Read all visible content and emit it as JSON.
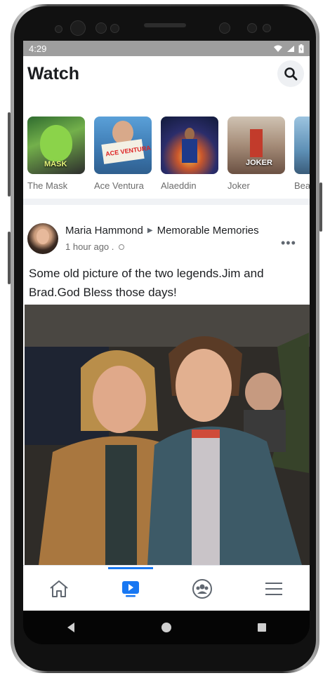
{
  "status_bar": {
    "time": "4:29"
  },
  "header": {
    "title": "Watch"
  },
  "shows": [
    {
      "name": "The Mask",
      "poster_text": "MASK",
      "color": "#3a7a3a"
    },
    {
      "name": "Ace Ventura",
      "poster_text": "ACE VENTURA",
      "color": "#4a8fc7"
    },
    {
      "name": "Alaeddin",
      "poster_text": "",
      "color": "#1f2f6b"
    },
    {
      "name": "Joker",
      "poster_text": "JOKER",
      "color": "#8a5a4a"
    },
    {
      "name": "Bea",
      "poster_text": "",
      "color": "#6fa0c4"
    }
  ],
  "post": {
    "author": "Maria Hammond",
    "group": "Memorable Memories",
    "time": "1 hour ago .",
    "text": "Some old picture of the two legends.Jim and Brad.God Bless those days!"
  },
  "colors": {
    "accent": "#1877f2",
    "status_bar": "#9e9e9e"
  },
  "icons": [
    "search-icon",
    "home-icon",
    "watch-icon",
    "groups-icon",
    "menu-icon",
    "back-icon",
    "home-circle-icon",
    "recents-icon"
  ]
}
